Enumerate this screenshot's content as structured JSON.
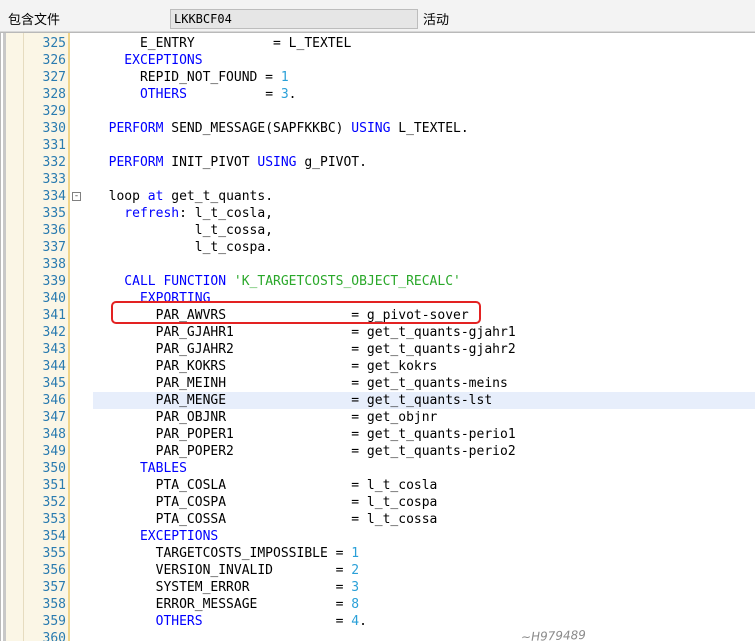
{
  "header": {
    "include_label": "包含文件",
    "include_value": "LKKBCF04",
    "status": "活动"
  },
  "watermark": "~H979489",
  "colors": {
    "keyword": "#0000ff",
    "literal": "#2aa0d8",
    "string": "#2aa82a",
    "line_number": "#2a7bb0",
    "highlight_box": "#e32222"
  },
  "lines": [
    {
      "no": "325",
      "parts": [
        {
          "t": "      E_ENTRY          = L_TEXTEL",
          "c": ""
        }
      ]
    },
    {
      "no": "326",
      "parts": [
        {
          "t": "    EXCEPTIONS",
          "c": "kw"
        }
      ]
    },
    {
      "no": "327",
      "parts": [
        {
          "t": "      REPID_NOT_FOUND = ",
          "c": ""
        },
        {
          "t": "1",
          "c": "lit"
        }
      ]
    },
    {
      "no": "328",
      "parts": [
        {
          "t": "      OTHERS",
          "c": "kw"
        },
        {
          "t": "          = ",
          "c": ""
        },
        {
          "t": "3",
          "c": "lit"
        },
        {
          "t": ".",
          "c": ""
        }
      ]
    },
    {
      "no": "329",
      "parts": []
    },
    {
      "no": "330",
      "parts": [
        {
          "t": "  PERFORM",
          "c": "kw"
        },
        {
          "t": " SEND_MESSAGE(SAPFKKBC) ",
          "c": ""
        },
        {
          "t": "USING",
          "c": "kw"
        },
        {
          "t": " L_TEXTEL.",
          "c": ""
        }
      ]
    },
    {
      "no": "331",
      "parts": []
    },
    {
      "no": "332",
      "parts": [
        {
          "t": "  PERFORM",
          "c": "kw"
        },
        {
          "t": " INIT_PIVOT ",
          "c": ""
        },
        {
          "t": "USING",
          "c": "kw"
        },
        {
          "t": " g_PIVOT.",
          "c": ""
        }
      ]
    },
    {
      "no": "333",
      "parts": []
    },
    {
      "no": "334",
      "fold": "-",
      "parts": [
        {
          "t": "  loop",
          "c": ""
        },
        {
          "t": " at",
          "c": "kw"
        },
        {
          "t": " get_t_quants.",
          "c": ""
        }
      ]
    },
    {
      "no": "335",
      "parts": [
        {
          "t": "    refresh",
          "c": "kw"
        },
        {
          "t": ": l_t_cosla,",
          "c": ""
        }
      ]
    },
    {
      "no": "336",
      "parts": [
        {
          "t": "             l_t_cossa,",
          "c": ""
        }
      ]
    },
    {
      "no": "337",
      "parts": [
        {
          "t": "             l_t_cospa.",
          "c": ""
        }
      ]
    },
    {
      "no": "338",
      "parts": []
    },
    {
      "no": "339",
      "parts": [
        {
          "t": "    CALL FUNCTION",
          "c": "kw"
        },
        {
          "t": " ",
          "c": ""
        },
        {
          "t": "'K_TARGETCOSTS_OBJECT_RECALC'",
          "c": "str"
        }
      ]
    },
    {
      "no": "340",
      "parts": [
        {
          "t": "      EXPORTING",
          "c": "kw"
        }
      ]
    },
    {
      "no": "341",
      "parts": [
        {
          "t": "        PAR_AWVRS                = g_pivot-sover",
          "c": ""
        }
      ]
    },
    {
      "no": "342",
      "parts": [
        {
          "t": "        PAR_GJAHR1               = get_t_quants-gjahr1",
          "c": ""
        }
      ]
    },
    {
      "no": "343",
      "parts": [
        {
          "t": "        PAR_GJAHR2               = get_t_quants-gjahr2",
          "c": ""
        }
      ]
    },
    {
      "no": "344",
      "parts": [
        {
          "t": "        PAR_KOKRS                = get_kokrs",
          "c": ""
        }
      ]
    },
    {
      "no": "345",
      "parts": [
        {
          "t": "        PAR_MEINH                = get_t_quants-meins",
          "c": ""
        }
      ]
    },
    {
      "no": "346",
      "cursor": true,
      "parts": [
        {
          "t": "        PAR_MENGE                = get_t_quants-lst",
          "c": ""
        }
      ]
    },
    {
      "no": "347",
      "parts": [
        {
          "t": "        PAR_OBJNR                = get_objnr",
          "c": ""
        }
      ]
    },
    {
      "no": "348",
      "parts": [
        {
          "t": "        PAR_POPER1               = get_t_quants-perio1",
          "c": ""
        }
      ]
    },
    {
      "no": "349",
      "parts": [
        {
          "t": "        PAR_POPER2               = get_t_quants-perio2",
          "c": ""
        }
      ]
    },
    {
      "no": "350",
      "parts": [
        {
          "t": "      TABLES",
          "c": "kw"
        }
      ]
    },
    {
      "no": "351",
      "parts": [
        {
          "t": "        PTA_COSLA                = l_t_cosla",
          "c": ""
        }
      ]
    },
    {
      "no": "352",
      "parts": [
        {
          "t": "        PTA_COSPA                = l_t_cospa",
          "c": ""
        }
      ]
    },
    {
      "no": "353",
      "parts": [
        {
          "t": "        PTA_COSSA                = l_t_cossa",
          "c": ""
        }
      ]
    },
    {
      "no": "354",
      "parts": [
        {
          "t": "      EXCEPTIONS",
          "c": "kw"
        }
      ]
    },
    {
      "no": "355",
      "parts": [
        {
          "t": "        TARGETCOSTS_IMPOSSIBLE = ",
          "c": ""
        },
        {
          "t": "1",
          "c": "lit"
        }
      ]
    },
    {
      "no": "356",
      "parts": [
        {
          "t": "        VERSION_INVALID        = ",
          "c": ""
        },
        {
          "t": "2",
          "c": "lit"
        }
      ]
    },
    {
      "no": "357",
      "parts": [
        {
          "t": "        SYSTEM_ERROR           = ",
          "c": ""
        },
        {
          "t": "3",
          "c": "lit"
        }
      ]
    },
    {
      "no": "358",
      "parts": [
        {
          "t": "        ERROR_MESSAGE          = ",
          "c": ""
        },
        {
          "t": "8",
          "c": "lit"
        }
      ]
    },
    {
      "no": "359",
      "parts": [
        {
          "t": "        OTHERS",
          "c": "kw"
        },
        {
          "t": "                 = ",
          "c": ""
        },
        {
          "t": "4",
          "c": "lit"
        },
        {
          "t": ".",
          "c": ""
        }
      ]
    },
    {
      "no": "360",
      "parts": []
    }
  ]
}
